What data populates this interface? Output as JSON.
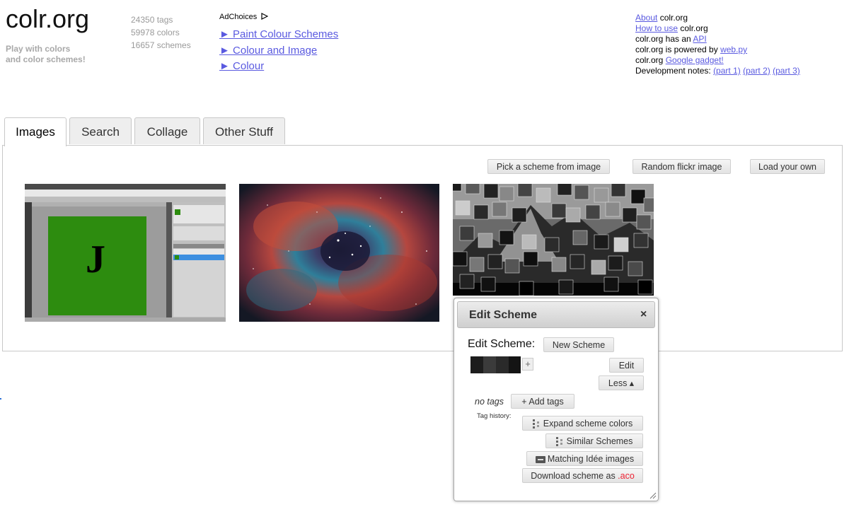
{
  "header": {
    "logo": "colr.org",
    "tagline_line1": "Play with colors",
    "tagline_line2": "and color schemes!",
    "stats": {
      "tags": "24350 tags",
      "colors": "59978 colors",
      "schemes": "16657 schemes"
    },
    "adchoices": "AdChoices",
    "ad_links": [
      "► Paint Colour Schemes",
      "► Colour and Image",
      "► Colour"
    ]
  },
  "top_links": {
    "about_link": "About",
    "about_rest": " colr.org",
    "howto_link": "How to use",
    "howto_rest": " colr.org",
    "api_pre": "colr.org has an ",
    "api_link": "API",
    "webpy_pre": "colr.org is powered by ",
    "webpy_link": "web.py",
    "gadget_pre": "colr.org ",
    "gadget_link": "Google gadget!",
    "dev_pre": "Development notes: ",
    "dev_part1": "(part 1)",
    "dev_part2": "(part 2)",
    "dev_part3": "(part 3)"
  },
  "tabs": [
    {
      "label": "Images",
      "active": true
    },
    {
      "label": "Search",
      "active": false
    },
    {
      "label": "Collage",
      "active": false
    },
    {
      "label": "Other Stuff",
      "active": false
    }
  ],
  "panel": {
    "pick_button": "Pick a scheme from image",
    "random_button": "Random flickr image",
    "load_button": "Load your own",
    "ps_letter": "J"
  },
  "dialog": {
    "title": "Edit Scheme",
    "close": "×",
    "edit_label": "Edit Scheme:",
    "new_button": "New Scheme",
    "swatch_colors": [
      "#1d1d1d",
      "#3b3b3b",
      "#2a2a2a",
      "#141414"
    ],
    "plus": "+",
    "edit_button": "Edit",
    "less_button": "Less ▴",
    "no_tags": "no tags",
    "add_tags_button": "+ Add tags",
    "tag_history": "Tag history:",
    "expand_button": "Expand scheme colors",
    "similar_button": "Similar Schemes",
    "matching_button": "Matching Idée images",
    "download_button_pre": "Download scheme as ",
    "download_button_ext": ".aco"
  },
  "colors": {
    "link": "#5a5ae0",
    "ps_green": "#2d8c0f",
    "accent_red": "#e23"
  }
}
